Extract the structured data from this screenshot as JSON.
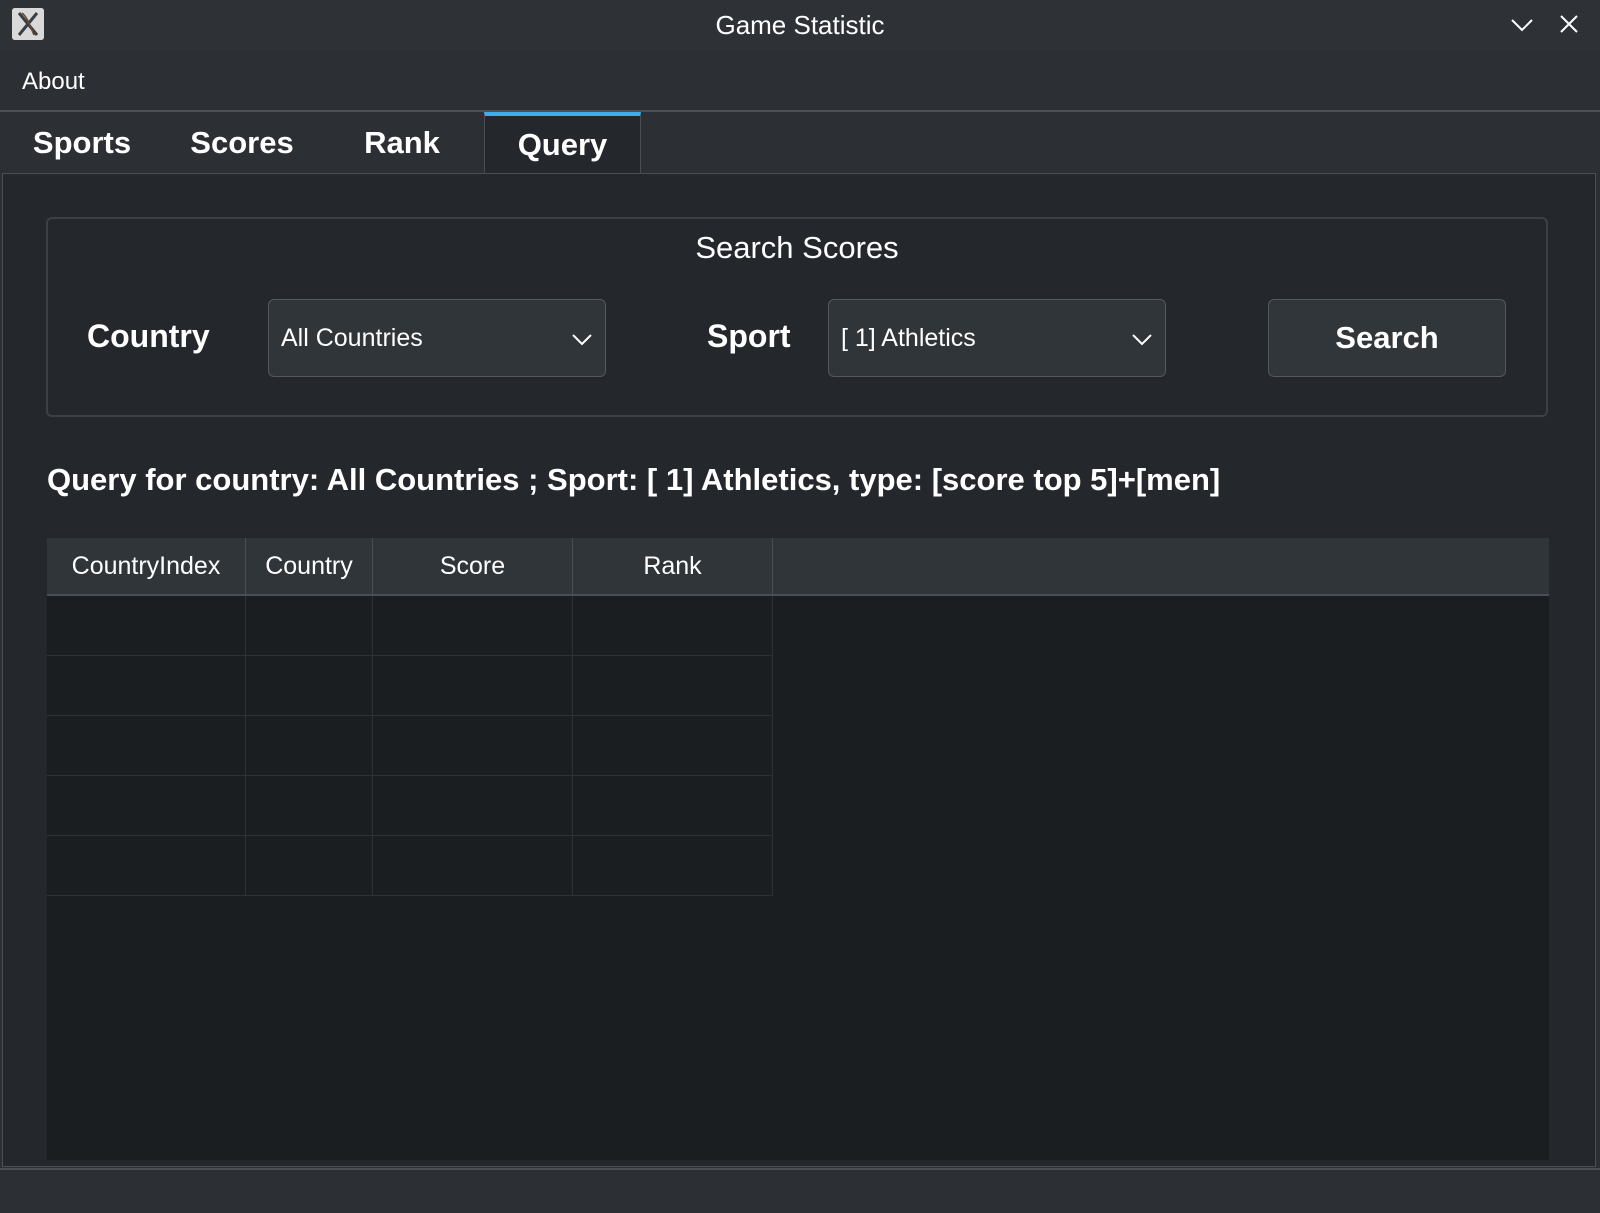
{
  "window": {
    "title": "Game Statistic",
    "app_icon": "x-window-icon",
    "controls": [
      "chevron-down-icon",
      "close-icon"
    ]
  },
  "menu": {
    "items": [
      "About"
    ]
  },
  "tabs": [
    {
      "label": "Sports",
      "active": false
    },
    {
      "label": "Scores",
      "active": false
    },
    {
      "label": "Rank",
      "active": false
    },
    {
      "label": "Query",
      "active": true
    }
  ],
  "search": {
    "title": "Search Scores",
    "country_label": "Country",
    "country_value": "All Countries",
    "sport_label": "Sport",
    "sport_value": "[ 1] Athletics",
    "button_label": "Search"
  },
  "query_line": "Query for country: All Countries ; Sport: [ 1] Athletics, type: [score top 5]+[men]",
  "table": {
    "columns": [
      "CountryIndex",
      "Country",
      "Score",
      "Rank"
    ],
    "rows": [
      [
        "",
        "",
        "",
        ""
      ],
      [
        "",
        "",
        "",
        ""
      ],
      [
        "",
        "",
        "",
        ""
      ],
      [
        "",
        "",
        "",
        ""
      ],
      [
        "",
        "",
        "",
        ""
      ]
    ]
  },
  "colors": {
    "accent": "#3daee9",
    "background": "#2c3035",
    "table_background": "#1b1e21"
  }
}
